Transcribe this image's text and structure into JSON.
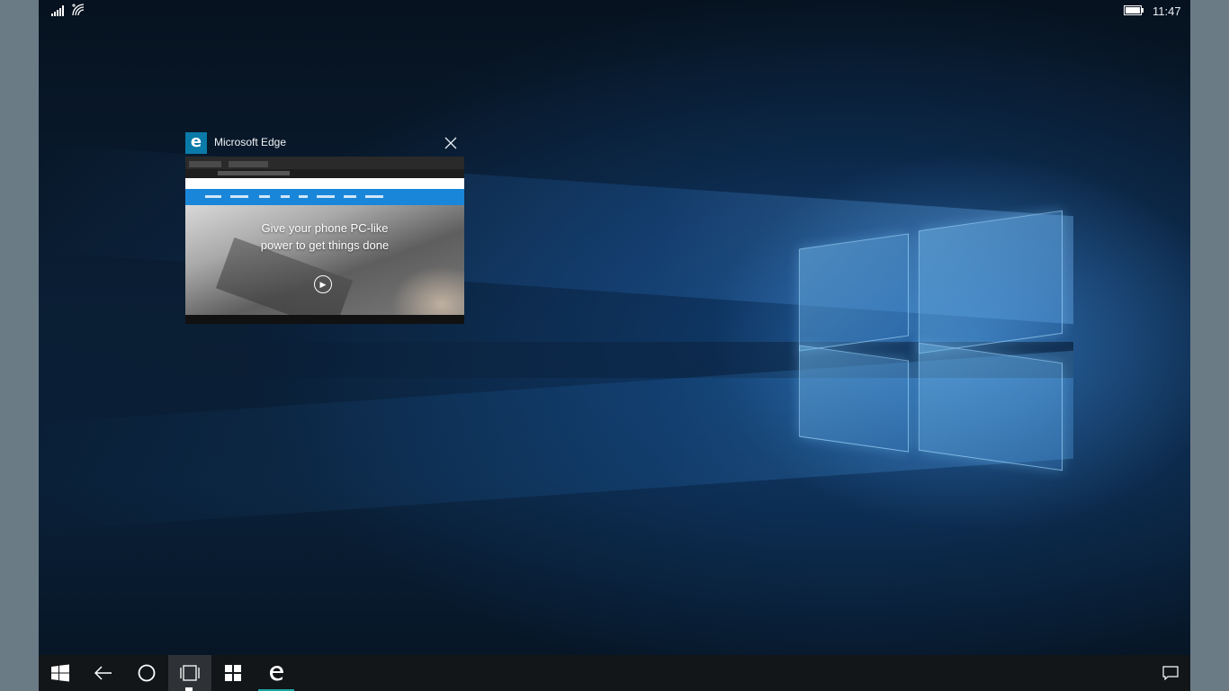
{
  "status_bar": {
    "signal_icon": "signal-bars-icon",
    "wifi_icon": "wifi-icon",
    "battery_icon": "battery-icon",
    "time": "11:47"
  },
  "task_view": {
    "app_icon": "edge-icon",
    "app_title": "Microsoft Edge",
    "close_icon": "close-icon",
    "preview": {
      "hero_text": "Give your phone PC-like power to get things done",
      "play_icon": "play-icon"
    }
  },
  "taskbar": {
    "buttons": [
      {
        "name": "start",
        "icon": "windows-logo-icon"
      },
      {
        "name": "back",
        "icon": "back-arrow-icon"
      },
      {
        "name": "cortana",
        "icon": "circle-icon"
      },
      {
        "name": "task-view",
        "icon": "task-view-icon"
      },
      {
        "name": "store",
        "icon": "store-icon"
      },
      {
        "name": "edge",
        "icon": "edge-icon"
      }
    ],
    "notification_icon": "action-center-icon"
  },
  "colors": {
    "accent": "#1aa5a5",
    "taskbar": "#121619",
    "edge_tile": "#0a7aa8",
    "site_nav": "#1a86d9"
  }
}
